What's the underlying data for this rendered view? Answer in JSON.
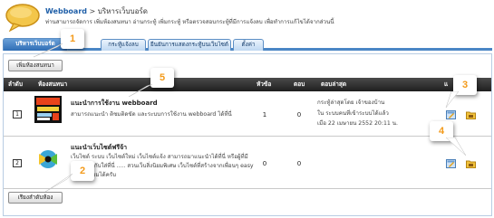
{
  "header": {
    "breadcrumb_link": "Webboard",
    "breadcrumb_sep": ">",
    "breadcrumb_current": "บริหารเว็บบอร์ด",
    "description": "ท่านสามารถจัดการ เพิ่มห้องสนทนา อ่านกระทู้ เพิ่มกระทู้ หรือตรวจสอบกระทู้ที่มีการแจ้งลบ เพื่อทำการแก้ไขได้จากส่วนนี้"
  },
  "tabs": [
    {
      "label": "บริหารเว็บบอร์ด",
      "active": true
    },
    {
      "label": "กระทู้แจ้งลบ",
      "active": false
    },
    {
      "label": "ยืนยันการแสดงกระทู้บนเว็บไซต์",
      "active": false
    },
    {
      "label": "ตั้งค่า",
      "active": false
    }
  ],
  "toolbar": {
    "add_room_label": "เพิ่มห้องสนทนา",
    "view_all_label": "เรียงลำดับห้อง"
  },
  "table": {
    "headers": {
      "order": "ลำดับ",
      "room": "ห้องสนทนา",
      "topics": "หัวข้อ",
      "replies": "ตอบ",
      "last_reply": "ตอบล่าสุด",
      "manage": "แ"
    },
    "rows": [
      {
        "num": "1",
        "title": "แนะนำการใช้งาน webboard",
        "desc": "สามารถแนะนำ ติชมติดขัด และระบบการใช้งาน webboard ได้ที่นี่",
        "topics": "1",
        "replies": "0",
        "last_line1": "กระทู้ล่าสุดโดย เจ้าของบ้าน",
        "last_line2": "ใน ระบบคนที่เข้าระบบได้แล้ว",
        "last_line3": "เมื่อ 22 เมษายน 2552 20:11 น."
      },
      {
        "num": "2",
        "title": "แนะนำเว็บไซต์ฟรีจ้า",
        "desc": "เว็บไซต์ ระบบ เว็บไซต์ใหม่ เว็บไซต์แจ้ง สามารถมาแนะนำได้ที่นี่ หรือผู้ที่มีความรู้จักกับใส่ที่นี่ ..... สวนเว็บสิ่งนิยมพิเศษ เว็บไซต์ที่สร้างจากเพื่อนๆ easy เข้าเยี่ยมชมได้ครับ",
        "topics": "0",
        "replies": "0",
        "last_line1": "",
        "last_line2": "",
        "last_line3": ""
      }
    ]
  },
  "callouts": [
    "1",
    "2",
    "3",
    "4",
    "5"
  ],
  "colors": {
    "accent": "#4a86c5",
    "header_dark": "#1f1f1f",
    "callout_number": "#f39a1a",
    "link": "#1f5fa8"
  },
  "icons": {
    "logo": "speech-bubble-icon",
    "edit": "edit-icon",
    "delete": "folder-icon"
  }
}
